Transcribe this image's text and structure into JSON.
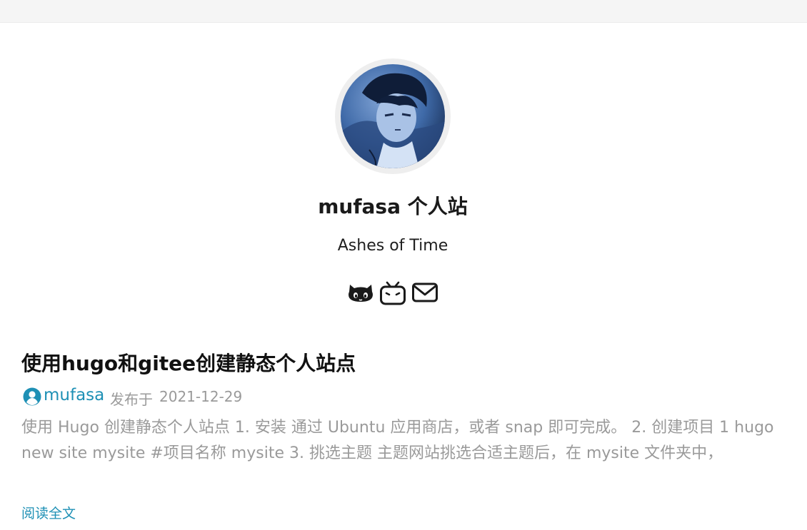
{
  "site": {
    "title": "mufasa 个人站",
    "subtitle": "Ashes of Time"
  },
  "social": [
    {
      "icon": "github-icon"
    },
    {
      "icon": "bilibili-icon"
    },
    {
      "icon": "email-icon"
    }
  ],
  "post": {
    "title": "使用hugo和gitee创建静态个人站点",
    "author": "mufasa",
    "published_label": "发布于",
    "date": "2021-12-29",
    "summary": "使用 Hugo 创建静态个人站点 1. 安装 通过 Ubuntu 应用商店，或者 snap 即可完成。 2. 创建项目 1 hugo new site mysite #项目名称 mysite 3. 挑选主题 主题网站挑选合适主题后，在 mysite 文件夹中，",
    "read_more": "阅读全文"
  },
  "colors": {
    "link": "#1e90b5",
    "muted": "#9a9a9a",
    "avatar_blue": "#3f6aa8",
    "topbar": "#f5f5f5"
  }
}
